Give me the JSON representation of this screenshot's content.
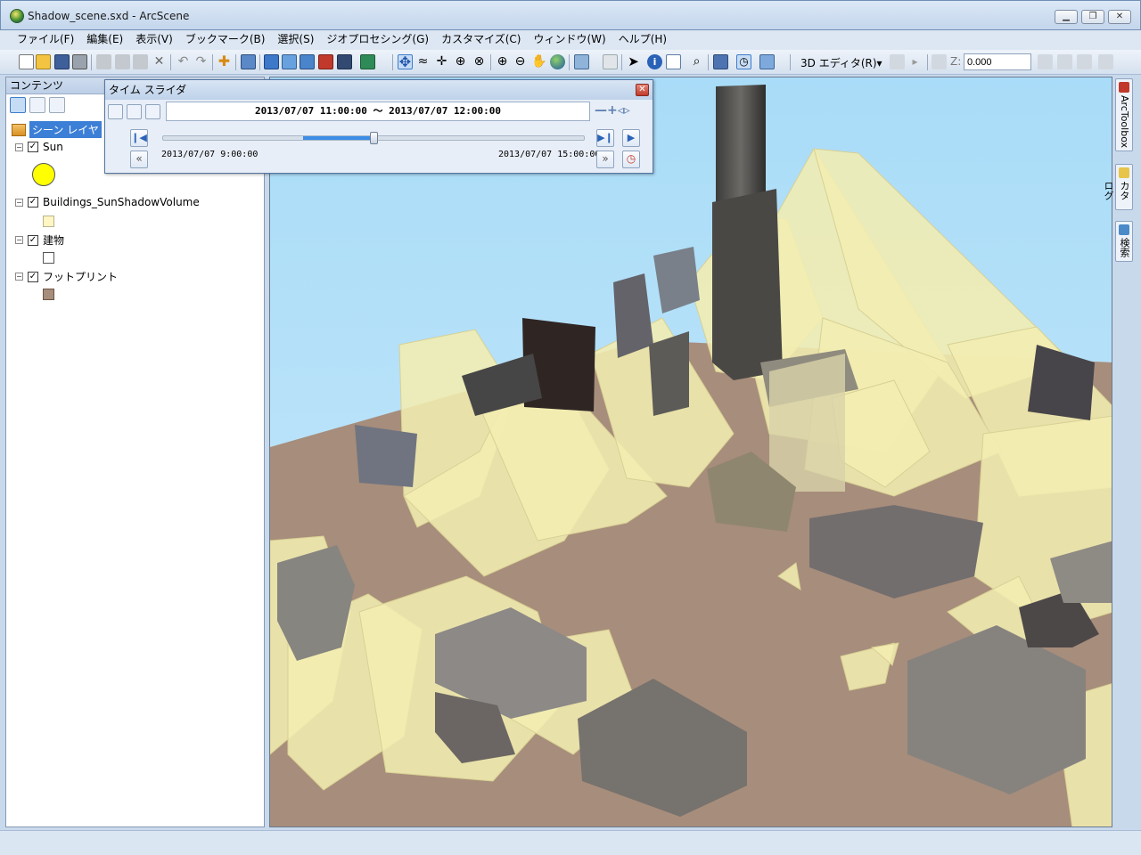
{
  "window": {
    "title": "Shadow_scene.sxd - ArcScene"
  },
  "menu": [
    "ファイル(F)",
    "編集(E)",
    "表示(V)",
    "ブックマーク(B)",
    "選択(S)",
    "ジオプロセシング(G)",
    "カスタマイズ(C)",
    "ウィンドウ(W)",
    "ヘルプ(H)"
  ],
  "toolbar": {
    "editor_label": "3D エディタ(R)▾",
    "z_label": "Z:",
    "z_value": "0.000"
  },
  "toc": {
    "title": "コンテンツ",
    "scene_layer": "シーン レイヤ",
    "layers": [
      {
        "name": "Sun",
        "checked": true,
        "symbol_color": "#ffff00"
      },
      {
        "name": "Buildings_SunShadowVolume",
        "checked": true,
        "symbol_color": "#fff6c4"
      },
      {
        "name": "建物",
        "checked": true,
        "symbol_color": "#ffffff"
      },
      {
        "name": "フットプリント",
        "checked": true,
        "symbol_color": "#a78d7b"
      }
    ]
  },
  "time_slider": {
    "title": "タイム スライダ",
    "current_range": "2013/07/07 11:00:00 ～ 2013/07/07 12:00:00",
    "start_time": "2013/07/07 9:00:00",
    "end_time": "2013/07/07 15:00:00",
    "window_start_fraction": 0.333,
    "window_end_fraction": 0.5
  },
  "side_tabs": [
    "ArcToolbox",
    "カタログ",
    "検索"
  ],
  "status": {
    "text": ""
  },
  "colors": {
    "sky": "#b4e0fa",
    "ground": "#a78d7b",
    "shadow": "#f2edb0",
    "selection": "#3c7fd6"
  }
}
